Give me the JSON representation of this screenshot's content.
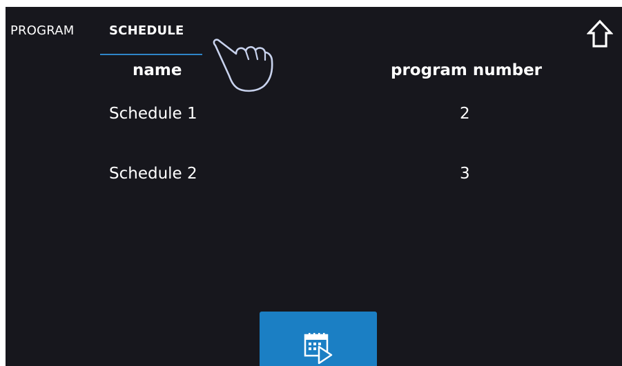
{
  "tabs": [
    {
      "label": "PROGRAM",
      "active": false
    },
    {
      "label": "SCHEDULE",
      "active": true
    }
  ],
  "table": {
    "columns": [
      "name",
      "program number"
    ],
    "rows": [
      {
        "name": "Schedule 1",
        "program_number": "2"
      },
      {
        "name": "Schedule 2",
        "program_number": "3"
      }
    ]
  },
  "icons": {
    "home": "home-icon",
    "pointer": "hand-pointer-icon",
    "start_schedule": "calendar-play-icon"
  },
  "colors": {
    "background": "#17171d",
    "accent": "#2f86c8",
    "button": "#1b7fc4",
    "text": "#ffffff",
    "hand_outline": "#c9d3ee"
  }
}
